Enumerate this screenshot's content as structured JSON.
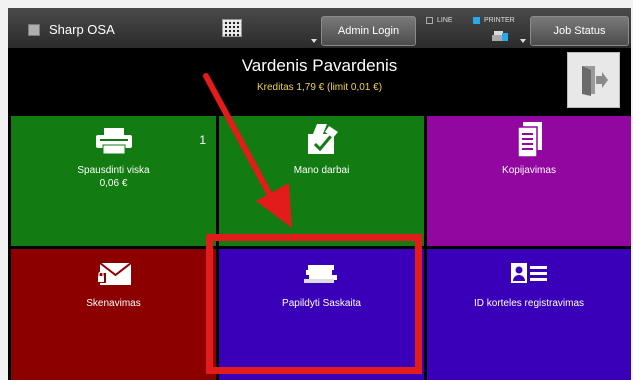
{
  "topbar": {
    "app_title": "Sharp OSA",
    "admin_login": "Admin Login",
    "line_label": "LINE",
    "printer_label": "PRINTER",
    "job_status": "Job Status"
  },
  "user": {
    "name": "Vardenis Pavardenis",
    "credit": "Kreditas 1,79 € (limit 0,01 €)"
  },
  "tiles": [
    {
      "label": "Spausdinti viska",
      "sub": "0,06 €",
      "count": "1",
      "icon": "printer-icon",
      "color": "#127b12"
    },
    {
      "label": "Mano darbai",
      "icon": "my-jobs-icon",
      "color": "#127b12"
    },
    {
      "label": "Kopijavimas",
      "icon": "copy-icon",
      "color": "#9107a0"
    },
    {
      "label": "Skenavimas",
      "icon": "scan-envelope-icon",
      "color": "#8c0000"
    },
    {
      "label": "Papildyti Saskaita",
      "icon": "money-stack-icon",
      "color": "#3a00b9"
    },
    {
      "label": "ID korteles registravimas",
      "icon": "id-card-icon",
      "color": "#3a00b9"
    }
  ],
  "annotation": {
    "highlight_color": "#e21b1b"
  }
}
